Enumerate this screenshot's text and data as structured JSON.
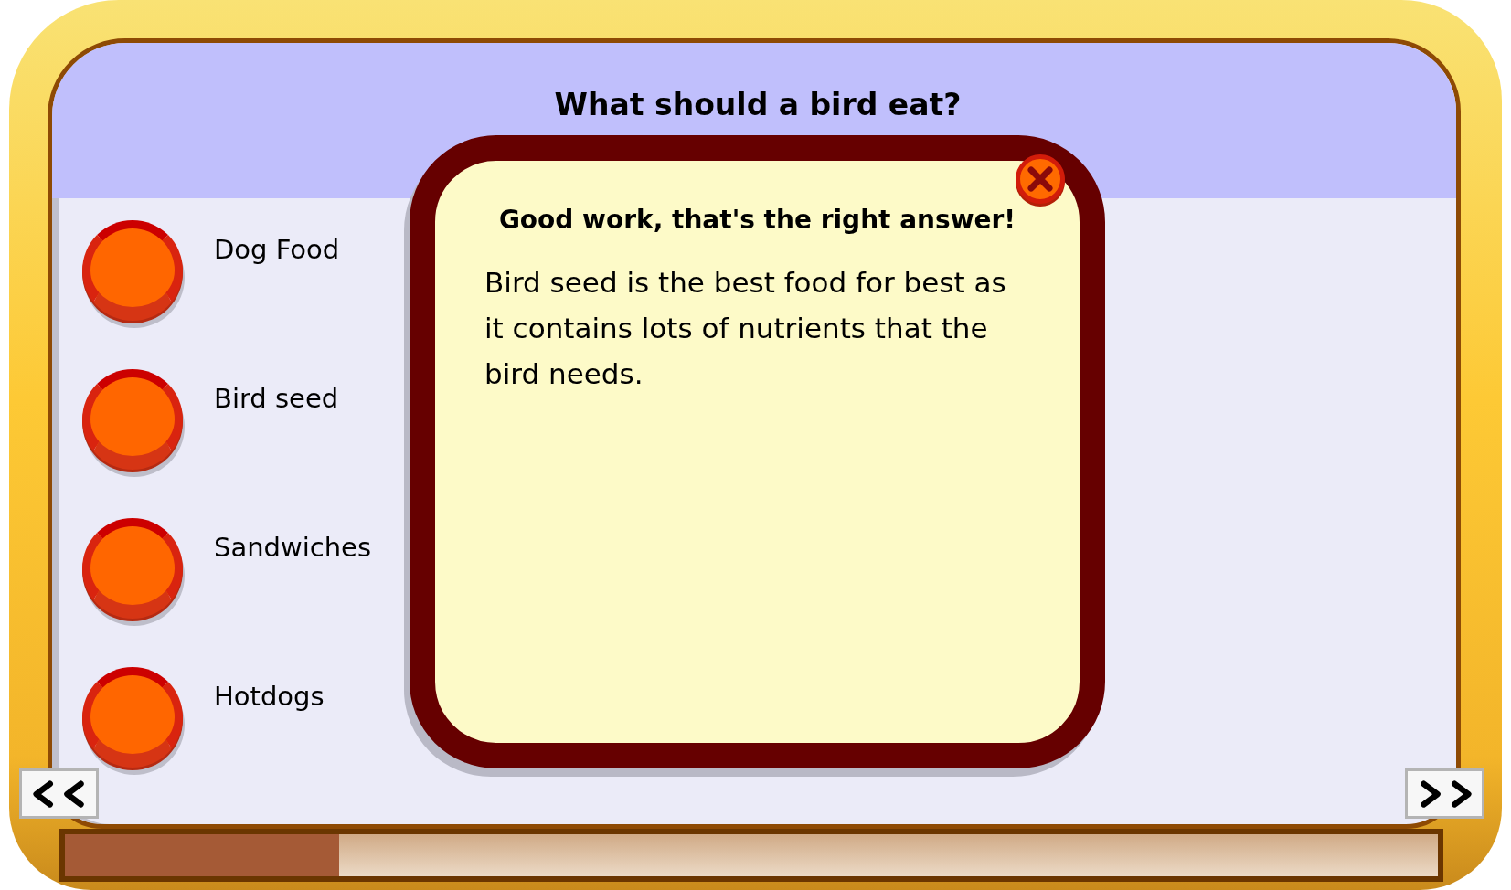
{
  "question": {
    "title": "What should a bird eat?"
  },
  "answers": [
    {
      "label": "Dog Food",
      "selected": false
    },
    {
      "label": "Bird seed",
      "selected": false
    },
    {
      "label": "Sandwiches",
      "selected": false
    },
    {
      "label": "Hotdogs",
      "selected": false
    }
  ],
  "feedback": {
    "heading": "Good work, that's the right answer!",
    "body": "Bird seed is the best food for best as it contains lots of nutrients that the bird needs."
  },
  "progress": {
    "level": 0.2
  }
}
